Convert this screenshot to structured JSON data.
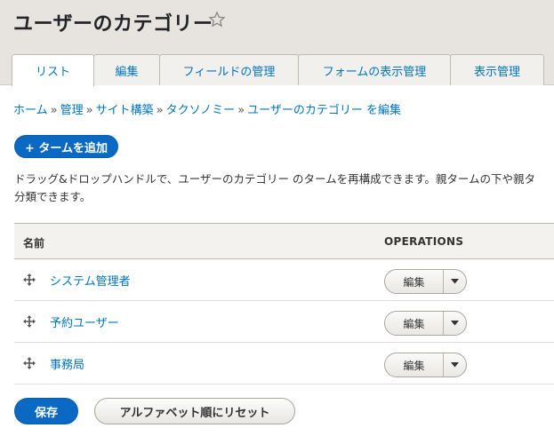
{
  "page": {
    "title": "ユーザーのカテゴリー"
  },
  "tabs": [
    {
      "label": "リスト"
    },
    {
      "label": "編集"
    },
    {
      "label": "フィールドの管理"
    },
    {
      "label": "フォームの表示管理"
    },
    {
      "label": "表示管理"
    }
  ],
  "breadcrumb": {
    "items": [
      "ホーム",
      "管理",
      "サイト構築",
      "タクソノミー",
      "ユーザーのカテゴリー を編集"
    ],
    "separator": "»"
  },
  "actions": {
    "add_term_label": "+ タームを追加"
  },
  "description": {
    "line1": "ドラッグ&ドロップハンドルで、ユーザーのカテゴリー のタームを再構成できます。親タームの下や親タ",
    "line2": "分類できます。"
  },
  "table": {
    "col_name": "名前",
    "col_ops": "OPERATIONS",
    "rows": [
      {
        "name": "システム管理者",
        "op_label": "編集"
      },
      {
        "name": "予約ユーザー",
        "op_label": "編集"
      },
      {
        "name": "事務局",
        "op_label": "編集"
      }
    ]
  },
  "footer": {
    "save_label": "保存",
    "reset_label": "アルファベット順にリセット"
  },
  "colors": {
    "primary": "#0a69c2",
    "link": "#0074bd",
    "header_bg": "#e7e4df"
  }
}
